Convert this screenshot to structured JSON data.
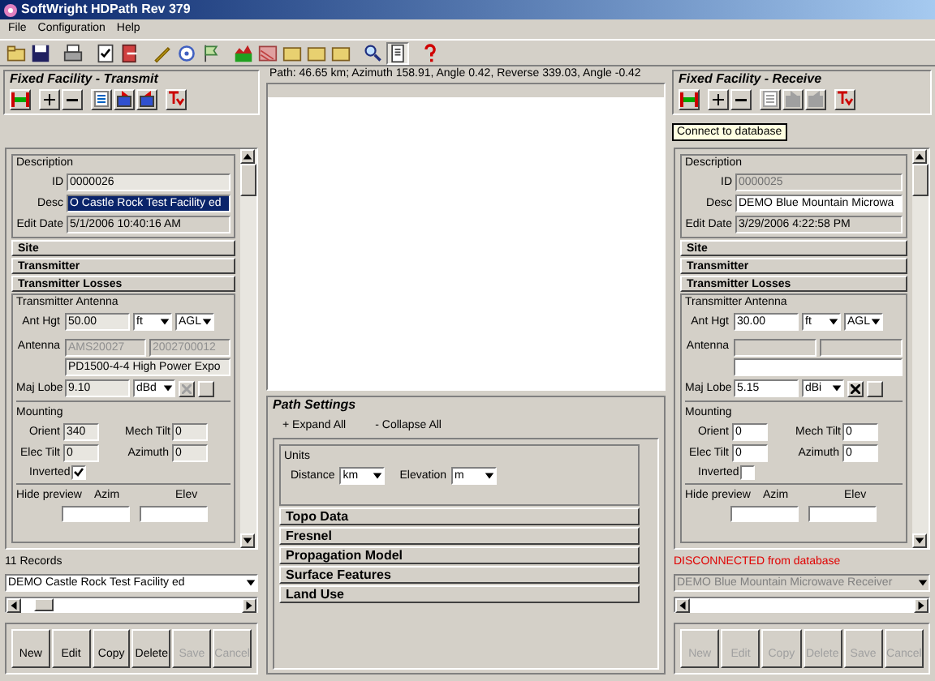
{
  "window": {
    "title": "SoftWright HDPath Rev 379"
  },
  "menu": [
    "File",
    "Configuration",
    "Help"
  ],
  "path_info": "Path: 46.65 km; Azimuth 158.91, Angle 0.42, Reverse 339.03, Angle -0.42",
  "path_settings": {
    "title": "Path Settings",
    "expand": "+ Expand All",
    "collapse": "- Collapse All",
    "units": {
      "label": "Units",
      "distance": {
        "label": "Distance",
        "value": "km"
      },
      "elevation": {
        "label": "Elevation",
        "value": "m"
      }
    },
    "sections": [
      "Topo Data",
      "Fresnel",
      "Propagation Model",
      "Surface Features",
      "Land Use"
    ]
  },
  "facilities": [
    {
      "title": "Fixed Facility - Transmit",
      "editable": false,
      "toolbar": [
        {
          "kind": "link",
          "disabled": false
        },
        {
          "kind": "add",
          "disabled": false
        },
        {
          "kind": "remove",
          "disabled": false
        },
        {
          "kind": "list",
          "disabled": false
        },
        {
          "kind": "import",
          "disabled": false
        },
        {
          "kind": "export",
          "disabled": false
        },
        {
          "kind": "tx",
          "disabled": false
        }
      ],
      "description": "Description",
      "id": {
        "label": "ID",
        "value": "0000026",
        "disabled": false
      },
      "desc": {
        "label": "Desc",
        "value": "O Castle Rock Test Facility ed",
        "selected": true
      },
      "edit_date": {
        "label": "Edit Date",
        "value": "5/1/2006 10:40:16 AM"
      },
      "sections": [
        "Site",
        "Transmitter",
        "Transmitter Losses"
      ],
      "antenna_group": "Transmitter Antenna",
      "ant_hgt": {
        "label": "Ant Hgt",
        "value": "50.00",
        "unit": "ft",
        "reference": "AGL"
      },
      "antenna": {
        "label": "Antenna",
        "codes": [
          "AMS20027",
          "2002700012"
        ],
        "model": "PD1500-4-4 High Power Expo"
      },
      "maj_lobe": {
        "label": "Maj Lobe",
        "value": "9.10",
        "unit": "dBd",
        "clear_disabled": true
      },
      "mounting": {
        "label": "Mounting",
        "fields": [
          {
            "label": "Orient",
            "value": "340"
          },
          {
            "label": "Mech Tilt",
            "value": "0"
          },
          {
            "label": "Elec Tilt",
            "value": "0"
          },
          {
            "label": "Azimuth",
            "value": "0"
          }
        ],
        "inverted": {
          "label": "Inverted",
          "checked": true
        }
      },
      "preview": {
        "label": "Hide preview",
        "columns": [
          "Azim",
          "Elev"
        ]
      },
      "status": {
        "text": "11 Records",
        "kind": "count"
      },
      "record": {
        "value": "DEMO Castle Rock Test Facility ed",
        "disabled": false
      },
      "buttons": [
        {
          "label": "New",
          "disabled": false
        },
        {
          "label": "Edit",
          "disabled": false
        },
        {
          "label": "Copy",
          "disabled": false
        },
        {
          "label": "Delete",
          "disabled": false
        },
        {
          "label": "Save",
          "disabled": true
        },
        {
          "label": "Cancel",
          "disabled": true
        }
      ]
    },
    {
      "title": "Fixed Facility - Receive",
      "editable": true,
      "tooltip": "Connect to database",
      "toolbar": [
        {
          "kind": "link",
          "disabled": false
        },
        {
          "kind": "add",
          "disabled": false
        },
        {
          "kind": "remove",
          "disabled": false
        },
        {
          "kind": "list",
          "disabled": true
        },
        {
          "kind": "import",
          "disabled": true
        },
        {
          "kind": "export",
          "disabled": true
        },
        {
          "kind": "tx",
          "disabled": false
        }
      ],
      "description": "Description",
      "id": {
        "label": "ID",
        "value": "0000025",
        "disabled": true
      },
      "desc": {
        "label": "Desc",
        "value": "DEMO Blue Mountain Microwa",
        "selected": false
      },
      "edit_date": {
        "label": "Edit Date",
        "value": "3/29/2006 4:22:58 PM"
      },
      "sections": [
        "Site",
        "Transmitter",
        "Transmitter Losses"
      ],
      "antenna_group": "Transmitter Antenna",
      "ant_hgt": {
        "label": "Ant Hgt",
        "value": "30.00",
        "unit": "ft",
        "reference": "AGL"
      },
      "antenna": {
        "label": "Antenna"
      },
      "maj_lobe": {
        "label": "Maj Lobe",
        "value": "5.15",
        "unit": "dBi",
        "clear_disabled": false
      },
      "mounting": {
        "label": "Mounting",
        "fields": [
          {
            "label": "Orient",
            "value": "0"
          },
          {
            "label": "Mech Tilt",
            "value": "0"
          },
          {
            "label": "Elec Tilt",
            "value": "0"
          },
          {
            "label": "Azimuth",
            "value": "0"
          }
        ],
        "inverted": {
          "label": "Inverted",
          "checked": false
        }
      },
      "preview": {
        "label": "Hide preview",
        "columns": [
          "Azim",
          "Elev"
        ]
      },
      "status": {
        "text": "DISCONNECTED from database",
        "kind": "error"
      },
      "record": {
        "value": "DEMO Blue Mountain Microwave Receiver",
        "disabled": true
      },
      "buttons": [
        {
          "label": "New",
          "disabled": true
        },
        {
          "label": "Edit",
          "disabled": true
        },
        {
          "label": "Copy",
          "disabled": true
        },
        {
          "label": "Delete",
          "disabled": true
        },
        {
          "label": "Save",
          "disabled": true
        },
        {
          "label": "Cancel",
          "disabled": true
        }
      ]
    }
  ]
}
